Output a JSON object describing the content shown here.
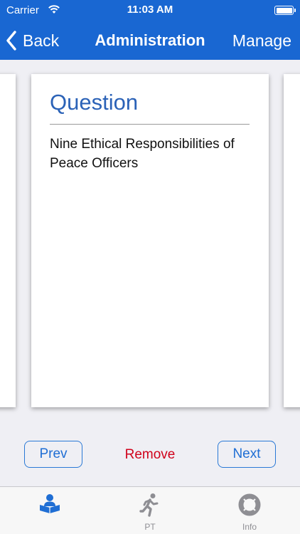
{
  "status_bar": {
    "carrier": "Carrier",
    "time": "11:03 AM",
    "battery_level": 1.0
  },
  "nav": {
    "back_label": "Back",
    "title": "Administration",
    "manage_label": "Manage"
  },
  "card": {
    "heading": "Question",
    "text": "Nine Ethical Responsibilities of Peace Officers"
  },
  "controls": {
    "prev_label": "Prev",
    "remove_label": "Remove",
    "next_label": "Next"
  },
  "tabs": [
    {
      "label": "",
      "icon": "study-icon",
      "selected": true
    },
    {
      "label": "PT",
      "icon": "runner-icon",
      "selected": false
    },
    {
      "label": "Info",
      "icon": "lifebuoy-icon",
      "selected": false
    }
  ],
  "colors": {
    "nav_background": "#1967d2",
    "accent": "#1f6ed4",
    "heading": "#2b62b7",
    "remove": "#d0021b",
    "tab_inactive": "#8e8e93"
  }
}
